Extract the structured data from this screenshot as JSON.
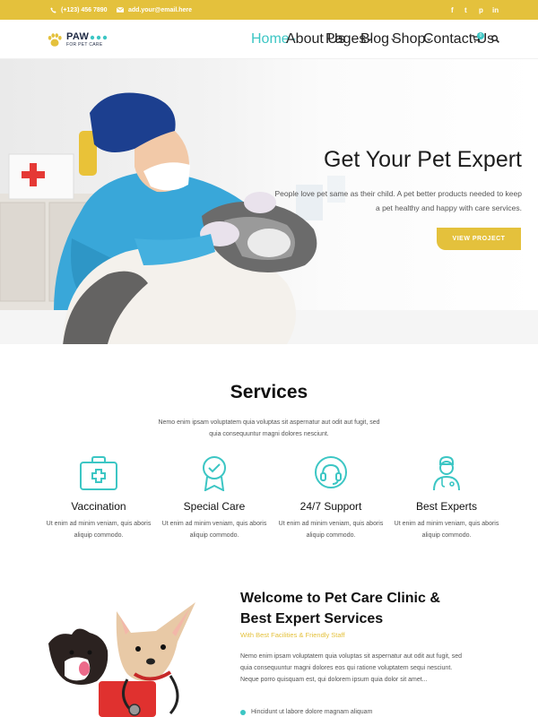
{
  "topbar": {
    "phone": "(+123) 456 7890",
    "email": "add.your@email.here",
    "social_icons": [
      "facebook-icon",
      "twitter-icon",
      "pinterest-icon",
      "linkedin-icon"
    ],
    "social_glyphs": [
      "f",
      "t",
      "p",
      "in"
    ]
  },
  "header": {
    "logo_name": "PAW",
    "logo_tagline": "FOR PET CARE",
    "nav": [
      {
        "label": "Home",
        "dropdown": true,
        "active": true
      },
      {
        "label": "About Us",
        "dropdown": false
      },
      {
        "label": "Pages",
        "dropdown": true
      },
      {
        "label": "Blog",
        "dropdown": true
      },
      {
        "label": "Shop",
        "dropdown": true
      },
      {
        "label": "Contact Us",
        "dropdown": false
      }
    ],
    "cart_count": "0"
  },
  "hero": {
    "title": "Get Your Pet Expert",
    "text": "People love pet same as their child. A pet better products needed to keep a pet healthy and happy with care services.",
    "button": "VIEW PROJECT"
  },
  "services": {
    "title": "Services",
    "subtitle": "Nemo enim ipsam voluptatem quia voluptas sit aspernatur aut odit aut fugit, sed quia consequuntur magni dolores nesciunt.",
    "items": [
      {
        "title": "Vaccination",
        "text": "Ut enim ad minim veniam, quis aboris aliquip commodo.",
        "icon": "first-aid-kit-icon"
      },
      {
        "title": "Special Care",
        "text": "Ut enim ad minim veniam, quis aboris aliquip commodo.",
        "icon": "award-ribbon-icon"
      },
      {
        "title": "24/7 Support",
        "text": "Ut enim ad minim veniam, quis aboris aliquip commodo.",
        "icon": "headset-support-icon"
      },
      {
        "title": "Best Experts",
        "text": "Ut enim ad minim veniam, quis aboris aliquip commodo.",
        "icon": "doctor-icon"
      }
    ]
  },
  "welcome": {
    "title_line1": "Welcome to Pet Care Clinic &",
    "title_line2": "Best Expert Services",
    "subtitle": "With Best Facilities & Friendly Staff",
    "text": "Nemo enim ipsam voluptatem quia voluptas sit aspernatur aut odit aut fugit, sed quia consequuntur magni dolores eos qui ratione voluptatem sequi nesciunt. Neque porro quisquam est, qui dolorem ipsum quia dolor sit amet...",
    "bullet": "Hincidunt ut labore dolore magnam aliquam"
  },
  "colors": {
    "accent_yellow": "#e4c13c",
    "accent_teal": "#3cc6c4",
    "text_dark": "#111111"
  }
}
